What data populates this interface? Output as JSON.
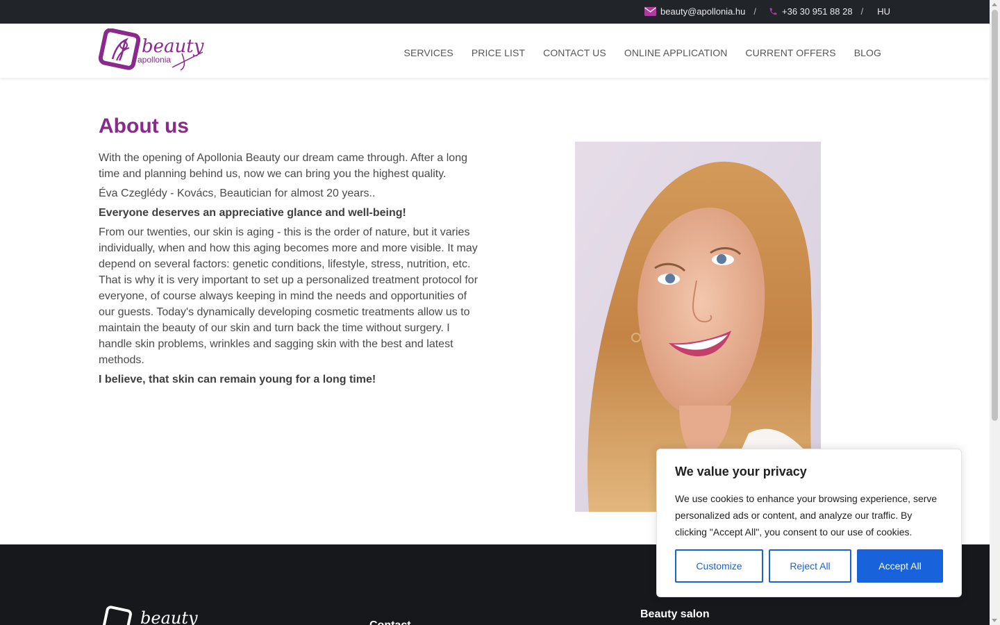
{
  "topbar": {
    "email": "beauty@apollonia.hu",
    "phone": "+36 30 951 88 28",
    "separator": "/",
    "language": "HU"
  },
  "logo": {
    "word1": "beauty",
    "word2": "apollonia"
  },
  "nav": [
    "SERVICES",
    "PRICE LIST",
    "CONTACT US",
    "ONLINE APPLICATION",
    "CURRENT OFFERS",
    "BLOG"
  ],
  "main": {
    "title": "About us",
    "paragraphs": [
      "With the opening of Apollonia Beauty our dream came through. After a long time and planning behind us, now we can bring you the highest quality.",
      "Éva Czeglédy - Kovács, Beautician for almost 20 years..",
      "Everyone deserves an appreciative glance and well-being!",
      "From our twenties, our skin is aging - this is the order of nature, but it varies individually, when and how this aging becomes more and more visible. It may depend on several factors: genetic conditions, lifestyle, stress, nutrition, etc. That is why it is very important to set up a personalized treatment protocol for everyone, of course always keeping in mind the needs and opportunities of our guests. Today's dynamically developing cosmetic treatments allow us to maintain the beauty of our skin and turn back the time without surgery. I handle skin problems, wrinkles and sagging skin with the best and latest methods.",
      "I believe, that skin can remain young for a long time!"
    ]
  },
  "footer": {
    "col2_heading": "Contact",
    "col3_heading": "Beauty salon"
  },
  "cookie": {
    "title": "We value your privacy",
    "text": "We use cookies to enhance your browsing experience, serve personalized ads or content, and analyze our traffic. By clicking \"Accept All\", you consent to our use of cookies.",
    "customize": "Customize",
    "reject": "Reject All",
    "accept": "Accept All"
  },
  "colors": {
    "brand": "#8a2a8c",
    "topbar": "#212529",
    "footer": "#16181b",
    "cookie_accent": "#1863dc"
  }
}
